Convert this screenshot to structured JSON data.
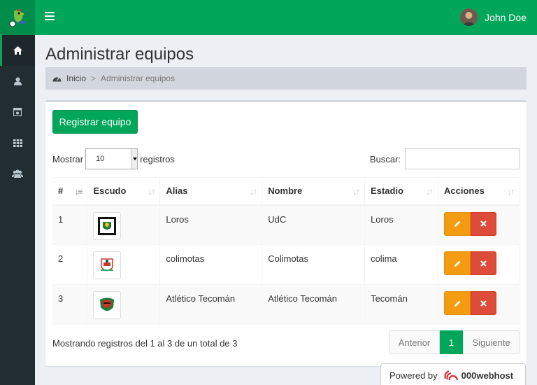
{
  "header": {
    "user_name": "John Doe"
  },
  "sidebar": {
    "items": [
      "home-icon",
      "user-icon",
      "team-badge-icon",
      "grid-icon",
      "users-icon"
    ]
  },
  "page": {
    "title": "Administrar equipos"
  },
  "breadcrumb": {
    "home": "Inicio",
    "separator": ">",
    "current": "Administrar equipos"
  },
  "toolbar": {
    "register_label": "Registrar equipo"
  },
  "table_controls": {
    "show_label": "Mostrar",
    "show_value": "10",
    "records_label": "registros",
    "search_label": "Buscar:"
  },
  "table": {
    "headers": [
      "#",
      "Escudo",
      "Alias",
      "Nombre",
      "Estadio",
      "Acciones"
    ],
    "rows": [
      {
        "num": "1",
        "alias": "Loros",
        "nombre": "UdC",
        "estadio": "Loros"
      },
      {
        "num": "2",
        "alias": "colimotas",
        "nombre": "Colimotas",
        "estadio": "colima"
      },
      {
        "num": "3",
        "alias": "Atlético Tecomán",
        "nombre": "Atlético Tecomán",
        "estadio": "Tecomán"
      }
    ]
  },
  "footer": {
    "info": "Mostrando registros del 1 al 3 de un total de 3",
    "prev": "Anterior",
    "page": "1",
    "next": "Siguiente"
  },
  "powered": {
    "label": "Powered by",
    "brand": "000webhost"
  },
  "colors": {
    "accent": "#00a65a",
    "edit": "#f39c12",
    "delete": "#dd4b39",
    "sidebar": "#222d32"
  }
}
